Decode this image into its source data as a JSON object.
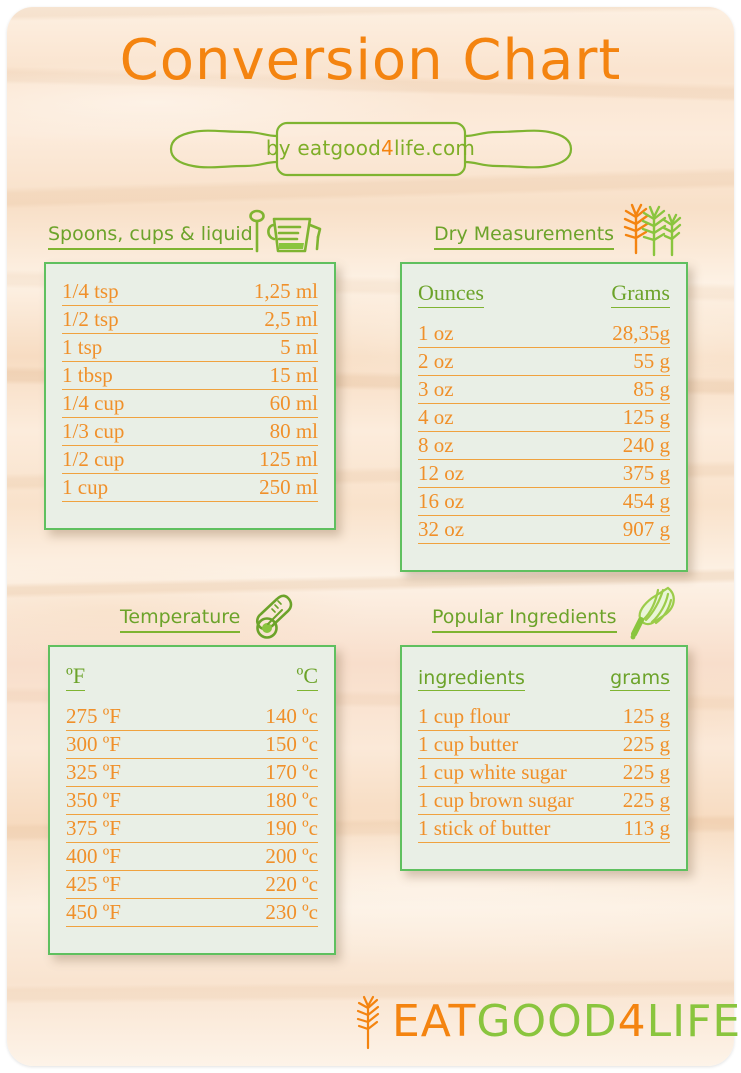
{
  "header": {
    "title": "Conversion Chart",
    "byline_prefix": "by eatgood",
    "byline_four": "4",
    "byline_suffix": "life.com",
    "rolling_pin_icon": "rolling-pin-icon"
  },
  "colors": {
    "orange": "#f48410",
    "row_orange": "#f0902a",
    "green_title": "#6ca32a",
    "card_border": "#5fc05f",
    "card_fill": "#e9efe6",
    "logo_green": "#8ac53e",
    "wood": "#f9e3cc"
  },
  "sections": [
    {
      "id": "spoons",
      "title": "Spoons, cups & liquid",
      "icon": "measuring-cup-icon",
      "has_header_row": false,
      "columns": [
        "",
        ""
      ],
      "rows": [
        [
          "1/4 tsp",
          "1,25 ml"
        ],
        [
          "1/2 tsp",
          "2,5 ml"
        ],
        [
          "1 tsp",
          "5 ml"
        ],
        [
          "1 tbsp",
          "15 ml"
        ],
        [
          "1/4 cup",
          "60 ml"
        ],
        [
          "1/3 cup",
          "80 ml"
        ],
        [
          "1/2 cup",
          "125 ml"
        ],
        [
          "1 cup",
          "250 ml"
        ]
      ]
    },
    {
      "id": "dry",
      "title": "Dry Measurements",
      "icon": "wheat-stalks-icon",
      "has_header_row": true,
      "header_style": "serif",
      "columns": [
        "Ounces",
        "Grams"
      ],
      "rows": [
        [
          "1 oz",
          "28,35g"
        ],
        [
          "2 oz",
          "55 g"
        ],
        [
          "3 oz",
          "85 g"
        ],
        [
          "4 oz",
          "125 g"
        ],
        [
          "8 oz",
          "240 g"
        ],
        [
          "12 oz",
          "375 g"
        ],
        [
          "16 oz",
          "454 g"
        ],
        [
          "32 oz",
          "907 g"
        ]
      ]
    },
    {
      "id": "temp",
      "title": "Temperature",
      "icon": "thermometer-icon",
      "has_header_row": true,
      "header_style": "serif",
      "columns": [
        "ºF",
        "ºC"
      ],
      "rows": [
        [
          "275 ºF",
          "140 ºc"
        ],
        [
          "300 ºF",
          "150 ºc"
        ],
        [
          "325 ºF",
          "170 ºc"
        ],
        [
          "350 ºF",
          "180 ºc"
        ],
        [
          "375 ºF",
          "190 ºc"
        ],
        [
          "400 ºF",
          "200 ºc"
        ],
        [
          "425 ºF",
          "220 ºc"
        ],
        [
          "450 ºF",
          "230 ºc"
        ]
      ]
    },
    {
      "id": "popular",
      "title": "Popular Ingredients",
      "icon": "whisk-icon",
      "has_header_row": true,
      "header_style": "sans",
      "columns": [
        "ingredients",
        "grams"
      ],
      "rows": [
        [
          "1 cup flour",
          "125 g"
        ],
        [
          "1 cup butter",
          "225 g"
        ],
        [
          "1 cup white sugar",
          "225 g"
        ],
        [
          "1 cup brown sugar",
          "225 g"
        ],
        [
          "1 stick of butter",
          "113 g"
        ]
      ]
    }
  ],
  "footer": {
    "logo_eat": "EAT",
    "logo_good": "GOOD",
    "logo_four": "4",
    "logo_life": "LIFE",
    "logo_icon": "wheat-stalk-icon"
  }
}
